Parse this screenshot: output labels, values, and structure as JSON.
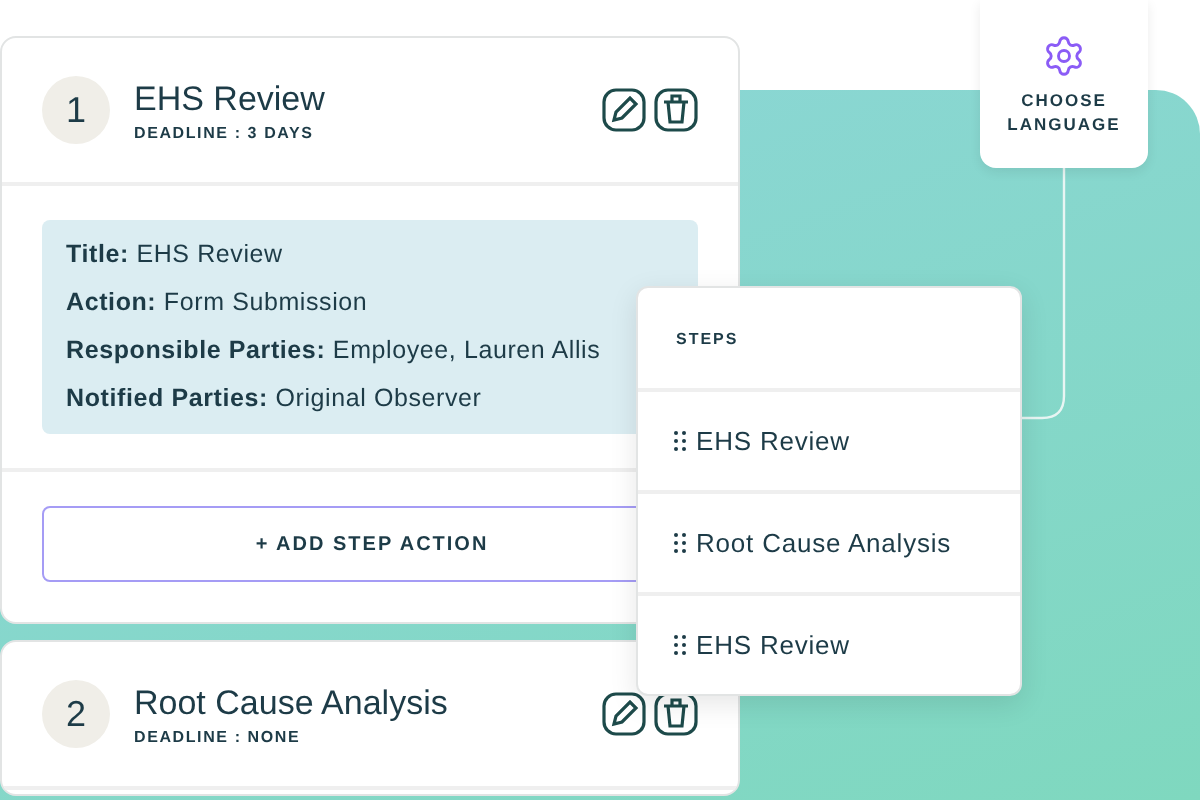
{
  "steps": [
    {
      "number": "1",
      "title": "EHS Review",
      "deadline": "DEADLINE : 3 DAYS",
      "details": [
        "**Title:** EHS Review",
        "**Action:** Form Submission",
        "**Responsible Parties:** Employee, Lauren Allis",
        "**Notified Parties:** Original Observer"
      ],
      "add_button": "+ ADD STEP ACTION"
    },
    {
      "number": "2",
      "title": "Root Cause Analysis",
      "deadline": "DEADLINE : NONE"
    }
  ],
  "language_card": {
    "label": "CHOOSE LANGUAGE"
  },
  "steps_panel": {
    "heading": "STEPS",
    "items": [
      "EHS Review",
      "Root Cause Analysis",
      "EHS Review"
    ]
  }
}
